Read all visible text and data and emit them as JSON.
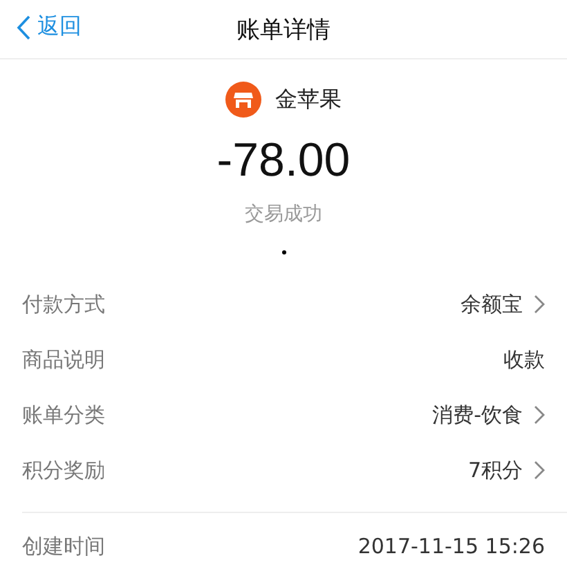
{
  "nav": {
    "back": "返回",
    "title": "账单详情"
  },
  "merchant": {
    "name": "金苹果"
  },
  "amount": "-78.00",
  "status": "交易成功",
  "details": [
    {
      "label": "付款方式",
      "value": "余额宝",
      "arrow": true
    },
    {
      "label": "商品说明",
      "value": "收款",
      "arrow": false
    },
    {
      "label": "账单分类",
      "value": "消费-饮食",
      "arrow": true
    },
    {
      "label": "积分奖励",
      "value": "7积分",
      "arrow": true
    }
  ],
  "extra": [
    {
      "label": "创建时间",
      "value": "2017-11-15 15:26"
    }
  ]
}
